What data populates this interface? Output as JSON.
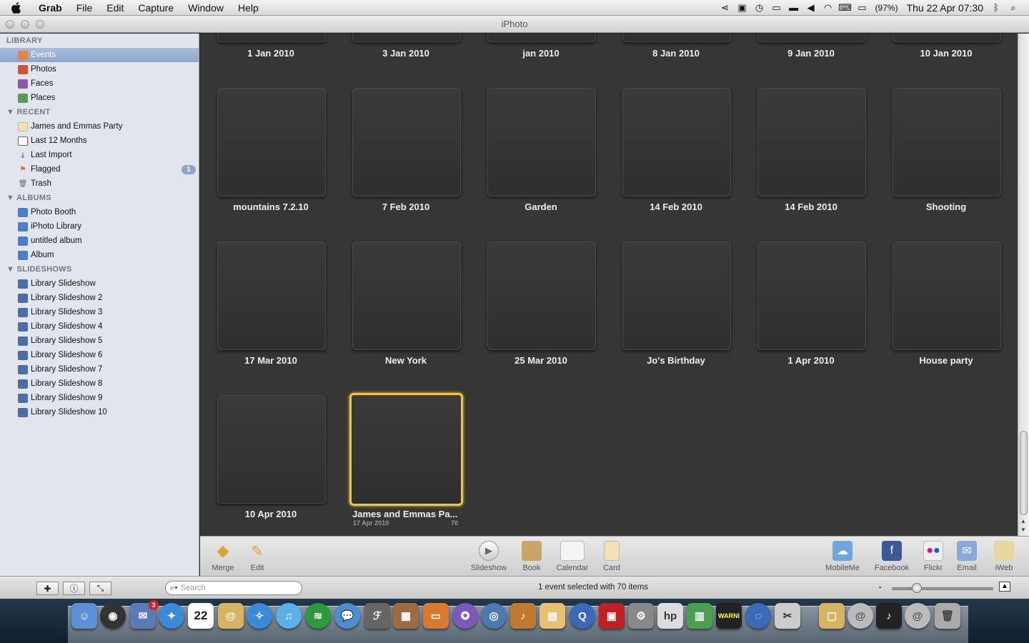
{
  "menubar": {
    "app": "Grab",
    "menus": [
      "File",
      "Edit",
      "Capture",
      "Window",
      "Help"
    ],
    "battery": "(97%)",
    "clock": "Thu 22 Apr  07:30"
  },
  "window": {
    "title": "iPhoto"
  },
  "sidebar": {
    "library_header": "LIBRARY",
    "library": [
      "Events",
      "Photos",
      "Faces",
      "Places"
    ],
    "recent_header": "RECENT",
    "recent": [
      "James and Emmas Party",
      "Last 12 Months",
      "Last Import",
      "Flagged",
      "Trash"
    ],
    "flagged_badge": "1",
    "albums_header": "ALBUMS",
    "albums": [
      "Photo Booth",
      "iPhoto Library",
      "untitled album",
      "Album"
    ],
    "slideshows_header": "SLIDESHOWS",
    "slideshows": [
      "Library Slideshow",
      "Library Slideshow 2",
      "Library Slideshow 3",
      "Library Slideshow 4",
      "Library Slideshow 5",
      "Library Slideshow 6",
      "Library Slideshow 7",
      "Library Slideshow 8",
      "Library Slideshow 9",
      "Library Slideshow 10"
    ]
  },
  "events": {
    "row0": [
      "1 Jan 2010",
      "3 Jan 2010",
      "jan 2010",
      "8 Jan 2010",
      "9 Jan 2010",
      "10 Jan 2010"
    ],
    "row1": [
      "mountains 7.2.10",
      "7 Feb 2010",
      "Garden",
      "14 Feb 2010",
      "14 Feb 2010",
      "Shooting"
    ],
    "row2": [
      "17 Mar 2010",
      "New York",
      "25 Mar 2010",
      "Jo's Birthday",
      "1 Apr 2010",
      "House party"
    ],
    "row3": [
      "10 Apr 2010"
    ],
    "selected": {
      "title": "James and Emmas Pa...",
      "date": "17 Apr 2010",
      "count": "70"
    }
  },
  "toolbar": {
    "left": [
      "Merge",
      "Edit"
    ],
    "center": [
      "Slideshow",
      "Book",
      "Calendar",
      "Card"
    ],
    "right": [
      "MobileMe",
      "Facebook",
      "Flickr",
      "Email",
      "iWeb"
    ]
  },
  "statusbar": {
    "search_placeholder": "Search",
    "status": "1 event selected with 70 items"
  },
  "dock": {
    "calendar_day": "22",
    "mail_badge": "3",
    "console_text": "WARNI"
  }
}
